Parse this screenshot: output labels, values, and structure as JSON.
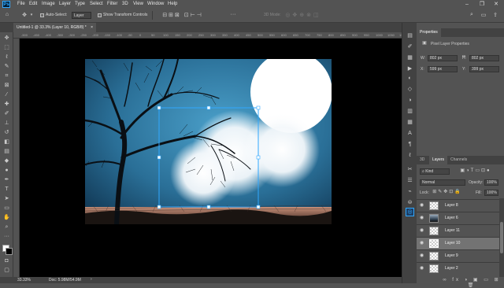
{
  "app": {
    "logo": "Ps"
  },
  "menu": [
    "File",
    "Edit",
    "Image",
    "Layer",
    "Type",
    "Select",
    "Filter",
    "3D",
    "View",
    "Window",
    "Help"
  ],
  "window_controls": {
    "minimize": "–",
    "restore": "❐",
    "close": "✕"
  },
  "options": {
    "auto_select_label": "Auto-Select:",
    "auto_select_target": "Layer",
    "show_transform_label": "Show Transform Controls",
    "mode_3d_label": "3D Mode:",
    "more": "···"
  },
  "document_tab": {
    "title": "Untitled-1 @ 33.3% (Layer 10, RGB/8) *",
    "close": "×"
  },
  "ruler_ticks": [
    "-500",
    "-450",
    "-400",
    "-350",
    "-300",
    "-250",
    "-200",
    "-150",
    "-100",
    "-50",
    "0",
    "50",
    "100",
    "150",
    "200",
    "250",
    "300",
    "350",
    "400",
    "450",
    "500",
    "550",
    "600",
    "650",
    "700",
    "750",
    "800",
    "850",
    "900",
    "950",
    "1000",
    "1050",
    "1100"
  ],
  "status": {
    "zoom": "33.33%",
    "doc": "Doc: 5.98M/54.9M",
    "arrow": "›"
  },
  "properties": {
    "tab": "Properties",
    "kind": "Pixel Layer Properties",
    "w_label": "W:",
    "w_value": "802 px",
    "h_label": "H:",
    "h_value": "802 px",
    "x_label": "X:",
    "x_value": "599 px",
    "y_label": "Y:",
    "y_value": "399 px",
    "link": "∞"
  },
  "layers_panel": {
    "tabs": [
      "3D",
      "Layers",
      "Channels"
    ],
    "filter": "Kind",
    "blend_mode": "Normal",
    "opacity_label": "Opacity:",
    "opacity_value": "100%",
    "lock_label": "Lock:",
    "fill_label": "Fill:",
    "fill_value": "100%",
    "layers": [
      "Layer 8",
      "Layer 6",
      "Layer 11",
      "Layer 10",
      "Layer 9",
      "Layer 2"
    ],
    "selected": "Layer 10"
  },
  "colors": {
    "accent": "#31a8ff",
    "selection": "#737373"
  }
}
